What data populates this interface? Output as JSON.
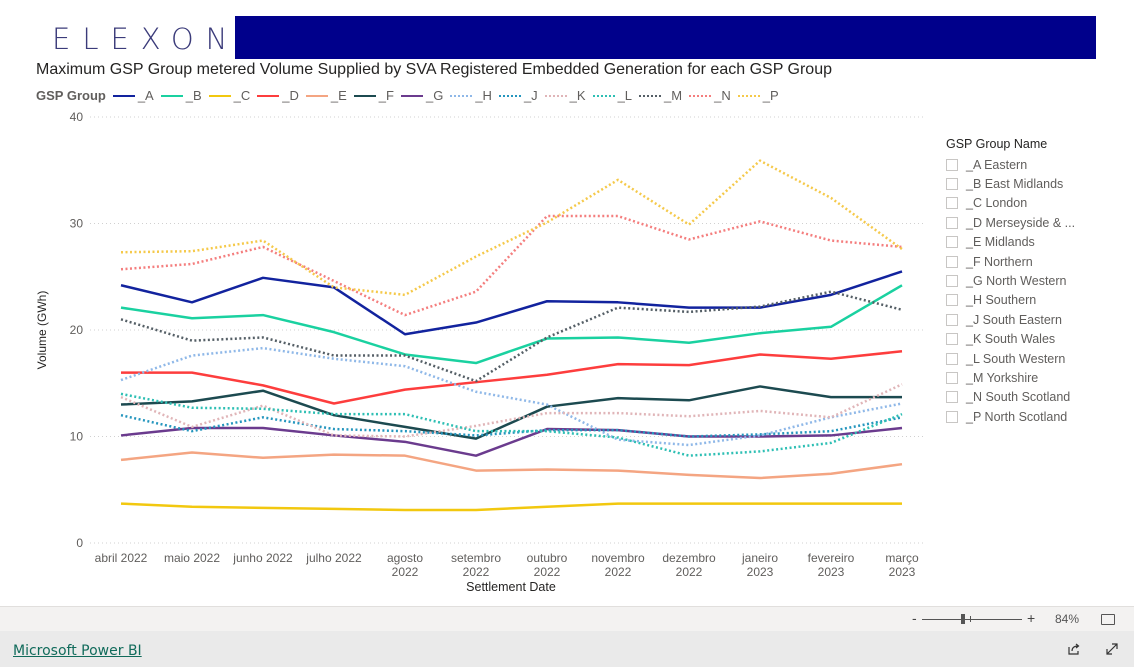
{
  "header": {
    "logo_text": "ELEXON",
    "banner_color": "#00008b"
  },
  "visual": {
    "title": "Maximum GSP Group metered Volume Supplied by SVA Registered Embedded Generation for each GSP Group",
    "legend_title": "GSP Group"
  },
  "chart_data": {
    "type": "line",
    "title": "Maximum GSP Group metered Volume Supplied by SVA Registered Embedded Generation for each GSP Group",
    "xlabel": "Settlement Date",
    "ylabel": "Volume (GWh)",
    "ylim": [
      0,
      40
    ],
    "yticks": [
      0,
      10,
      20,
      30,
      40
    ],
    "grid": true,
    "legend_position": "top-left",
    "categories": [
      "abril 2022",
      "maio 2022",
      "junho 2022",
      "julho 2022",
      "agosto 2022",
      "setembro 2022",
      "outubro 2022",
      "novembro 2022",
      "dezembro 2022",
      "janeiro 2023",
      "fevereiro 2023",
      "março 2023"
    ],
    "category_lines": [
      [
        "abril 2022"
      ],
      [
        "maio 2022"
      ],
      [
        "junho 2022"
      ],
      [
        "julho 2022"
      ],
      [
        "agosto",
        "2022"
      ],
      [
        "setembro",
        "2022"
      ],
      [
        "outubro",
        "2022"
      ],
      [
        "novembro",
        "2022"
      ],
      [
        "dezembro",
        "2022"
      ],
      [
        "janeiro",
        "2023"
      ],
      [
        "fevereiro",
        "2023"
      ],
      [
        "março",
        "2023"
      ]
    ],
    "series": [
      {
        "name": "_A",
        "color": "#12239e",
        "dash": "solid",
        "values": [
          24.2,
          22.6,
          24.9,
          24.0,
          19.6,
          20.7,
          22.7,
          22.6,
          22.1,
          22.1,
          23.3,
          25.5
        ]
      },
      {
        "name": "_B",
        "color": "#1ad1a0",
        "dash": "solid",
        "values": [
          22.1,
          21.1,
          21.4,
          19.8,
          17.7,
          16.9,
          19.2,
          19.3,
          18.8,
          19.7,
          20.3,
          24.2
        ]
      },
      {
        "name": "_C",
        "color": "#f2c80f",
        "dash": "solid",
        "values": [
          3.7,
          3.4,
          3.3,
          3.2,
          3.1,
          3.1,
          3.4,
          3.7,
          3.7,
          3.7,
          3.7,
          3.7
        ]
      },
      {
        "name": "_D",
        "color": "#fd3d3d",
        "dash": "solid",
        "values": [
          16.0,
          16.0,
          14.8,
          13.1,
          14.4,
          15.1,
          15.8,
          16.8,
          16.7,
          17.7,
          17.3,
          18.0
        ]
      },
      {
        "name": "_E",
        "color": "#f4a582",
        "dash": "solid",
        "values": [
          7.8,
          8.5,
          8.0,
          8.3,
          8.2,
          6.8,
          6.9,
          6.8,
          6.4,
          6.1,
          6.5,
          7.4
        ]
      },
      {
        "name": "_F",
        "color": "#1c4a50",
        "dash": "solid",
        "values": [
          13.0,
          13.3,
          14.3,
          12.0,
          10.9,
          9.8,
          12.8,
          13.6,
          13.4,
          14.7,
          13.7,
          13.7
        ]
      },
      {
        "name": "_G",
        "color": "#6b3b8e",
        "dash": "solid",
        "values": [
          10.1,
          10.8,
          10.8,
          10.1,
          9.5,
          8.2,
          10.7,
          10.6,
          10.0,
          10.0,
          10.1,
          10.8
        ]
      },
      {
        "name": "_H",
        "color": "#8fb8e8",
        "dash": "dotted",
        "values": [
          15.3,
          17.6,
          18.3,
          17.3,
          16.6,
          14.2,
          13.0,
          9.7,
          9.2,
          10.1,
          11.8,
          13.1
        ]
      },
      {
        "name": "_J",
        "color": "#2596be",
        "dash": "dotted",
        "values": [
          12.0,
          10.5,
          11.8,
          10.7,
          10.5,
          10.1,
          10.6,
          10.6,
          10.0,
          10.2,
          10.5,
          11.8
        ]
      },
      {
        "name": "_K",
        "color": "#e0b5b8",
        "dash": "dotted",
        "values": [
          13.7,
          10.9,
          12.9,
          10.1,
          10.0,
          11.0,
          12.2,
          12.2,
          11.9,
          12.4,
          11.8,
          14.9
        ]
      },
      {
        "name": "_L",
        "color": "#2ebfb4",
        "dash": "dotted",
        "values": [
          14.0,
          12.7,
          12.6,
          12.1,
          12.1,
          10.5,
          10.5,
          9.9,
          8.2,
          8.6,
          9.4,
          12.1
        ]
      },
      {
        "name": "_M",
        "color": "#555f66",
        "dash": "dotted",
        "values": [
          21.0,
          19.0,
          19.3,
          17.6,
          17.6,
          15.2,
          19.3,
          22.1,
          21.7,
          22.2,
          23.6,
          21.9
        ]
      },
      {
        "name": "_N",
        "color": "#f47e7e",
        "dash": "dotted",
        "values": [
          25.7,
          26.2,
          27.8,
          24.6,
          21.4,
          23.6,
          30.7,
          30.7,
          28.5,
          30.2,
          28.4,
          27.8
        ]
      },
      {
        "name": "_P",
        "color": "#f5c94a",
        "dash": "dotted",
        "values": [
          27.3,
          27.4,
          28.4,
          24.0,
          23.3,
          26.9,
          30.1,
          34.1,
          29.9,
          35.9,
          32.4,
          27.6
        ]
      }
    ]
  },
  "slicer": {
    "title": "GSP Group Name",
    "items": [
      {
        "label": "_A Eastern",
        "checked": false
      },
      {
        "label": "_B East Midlands",
        "checked": false
      },
      {
        "label": "_C London",
        "checked": false
      },
      {
        "label": "_D Merseyside & ...",
        "checked": false
      },
      {
        "label": "_E Midlands",
        "checked": false
      },
      {
        "label": "_F Northern",
        "checked": false
      },
      {
        "label": "_G North Western",
        "checked": false
      },
      {
        "label": "_H Southern",
        "checked": false
      },
      {
        "label": "_J South Eastern",
        "checked": false
      },
      {
        "label": "_K South Wales",
        "checked": false
      },
      {
        "label": "_L South Western",
        "checked": false
      },
      {
        "label": "_M Yorkshire",
        "checked": false
      },
      {
        "label": "_N South Scotland",
        "checked": false
      },
      {
        "label": "_P North Scotland",
        "checked": false
      }
    ]
  },
  "zoom": {
    "minus": "-",
    "plus": "+",
    "level": "84%",
    "level_value": 84
  },
  "footer": {
    "link": "Microsoft Power BI"
  }
}
